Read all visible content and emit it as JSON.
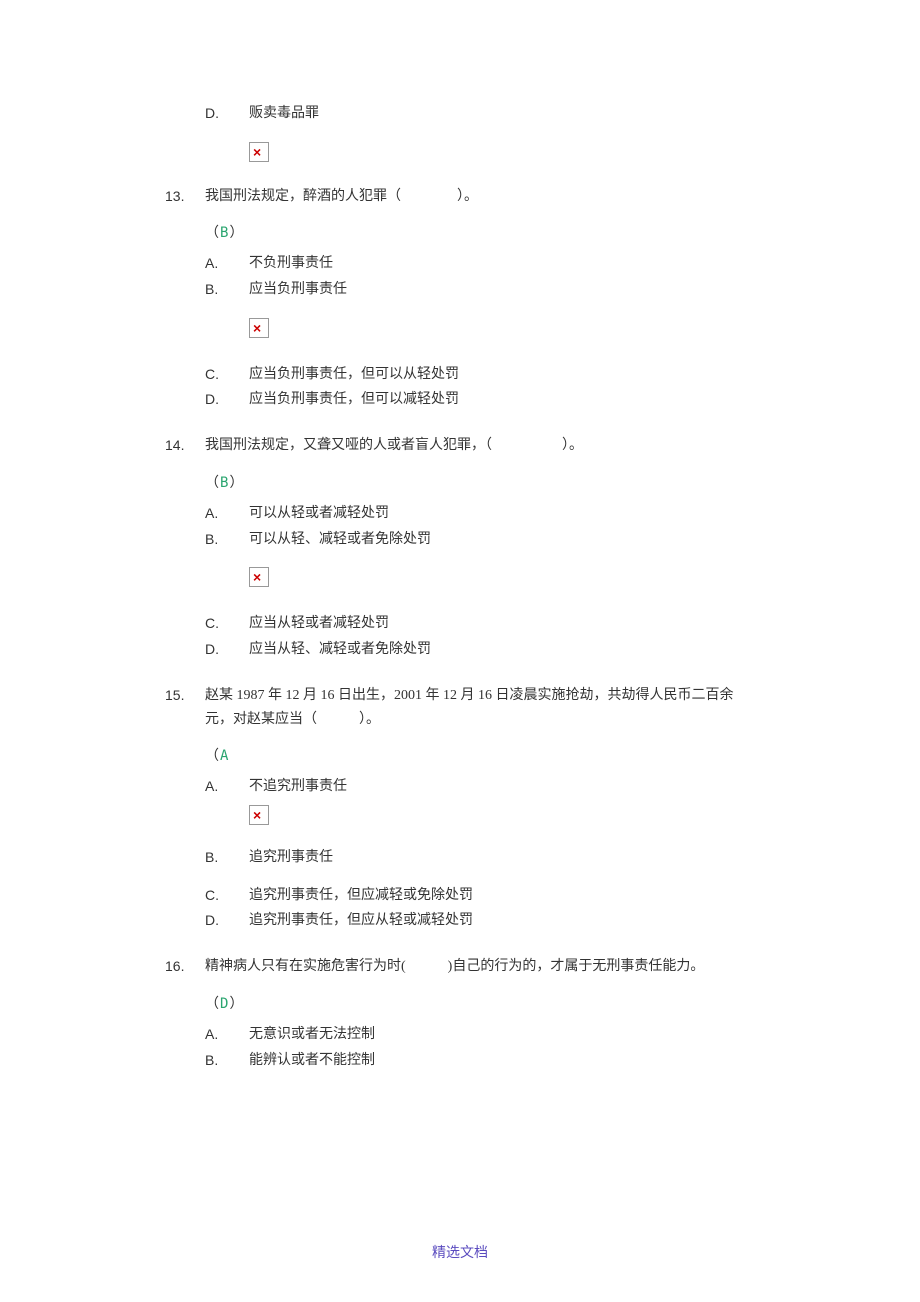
{
  "orphan_option": {
    "letter": "D.",
    "text": "贩卖毒品罪"
  },
  "questions": [
    {
      "num": "13.",
      "stem": "我国刑法规定，醉酒的人犯罪（　　　　）。",
      "answer": "B",
      "opts_before": [
        {
          "letter": "A.",
          "text": "不负刑事责任"
        },
        {
          "letter": "B.",
          "text": "应当负刑事责任"
        }
      ],
      "opts_after": [
        {
          "letter": "C.",
          "text": "应当负刑事责任，但可以从轻处罚"
        },
        {
          "letter": "D.",
          "text": "应当负刑事责任，但可以减轻处罚"
        }
      ]
    },
    {
      "num": "14.",
      "stem": "我国刑法规定，又聋又哑的人或者盲人犯罪，（　　　　　）。",
      "answer": "B",
      "opts_before": [
        {
          "letter": "A.",
          "text": "可以从轻或者减轻处罚"
        },
        {
          "letter": "B.",
          "text": "可以从轻、减轻或者免除处罚"
        }
      ],
      "opts_after": [
        {
          "letter": "C.",
          "text": "应当从轻或者减轻处罚"
        },
        {
          "letter": "D.",
          "text": "应当从轻、减轻或者免除处罚"
        }
      ]
    },
    {
      "num": "15.",
      "stem": "赵某 1987 年 12 月 16 日出生，2001 年 12 月 16 日凌晨实施抢劫，共劫得人民币二百余元，对赵某应当（　　　）。",
      "answer": "A",
      "opts_a": {
        "letter": "A.",
        "text": "不追究刑事责任"
      },
      "opts_rest": [
        {
          "letter": "B.",
          "text": "追究刑事责任"
        },
        {
          "letter": "C.",
          "text": "追究刑事责任，但应减轻或免除处罚"
        },
        {
          "letter": "D.",
          "text": "追究刑事责任，但应从轻或减轻处罚"
        }
      ]
    },
    {
      "num": "16.",
      "stem": "精神病人只有在实施危害行为时(　　　)自己的行为的，才属于无刑事责任能力。",
      "answer": "D",
      "opts_before": [
        {
          "letter": "A.",
          "text": "无意识或者无法控制"
        },
        {
          "letter": "B.",
          "text": "能辨认或者不能控制"
        }
      ],
      "opts_after": []
    }
  ],
  "footer": "精选文档"
}
